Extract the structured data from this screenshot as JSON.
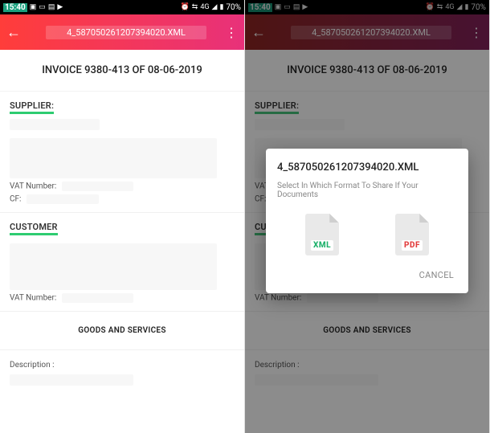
{
  "statusbar": {
    "time": "15:40",
    "net": "4G",
    "battery": "70%"
  },
  "appbar": {
    "title": "4_587050261207394020.XML"
  },
  "invoice": {
    "title": "INVOICE 9380-413 OF 08-06-2019",
    "supplier_label": "SUPPLIER:",
    "vat_label": "VAT Number:",
    "cf_label": "CF:",
    "customer_label": "CUSTOMER",
    "goods_label": "GOODS AND SERVICES",
    "desc_label": "Description :"
  },
  "dialog": {
    "title": "4_587050261207394020.XML",
    "subtitle": "Select In Which Format To Share If Your Documents",
    "opt_xml": "XML",
    "opt_pdf": "PDF",
    "cancel": "CANCEL"
  }
}
